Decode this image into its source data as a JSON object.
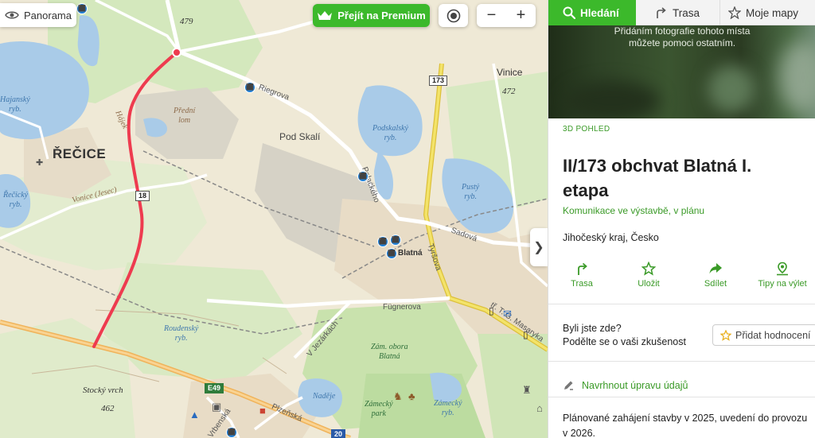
{
  "map": {
    "panorama_label": "Panorama",
    "premium_label": "Přejít na Premium",
    "zoom_out": "−",
    "zoom_in": "+",
    "collapse_arrow": "❯",
    "labels": {
      "town_recice": "ŘEČICE",
      "village_pod_skali": "Pod Skalí",
      "vinice": "Vinice",
      "vinice_elev": "472",
      "top_elev": "479",
      "hajansky": "Hajanský\nryb.",
      "recicky": "Řečický\nryb.",
      "podskalsky": "Podskalský\nryb.",
      "pusty": "Pustý\nryb.",
      "roudensky": "Roudenský\nryb.",
      "nadeje": "Naděje",
      "zamecky": "Zámecký\nryb.",
      "predni_lom": "Přední\nlom",
      "stocky_vrch": "Stocký vrch",
      "stocky_elev": "462",
      "zam_obora": "Zám. obora\nBlatná",
      "zamecky_park": "Zámecký\npark",
      "riegrova": "Riegrova",
      "palackeho": "Palackého",
      "sadova": "Sadová",
      "tyrsova": "Tyršova",
      "fugnerova": "Fügnerova",
      "v_jezarkach": "V Jezárkách",
      "plzenska": "Plzeňská",
      "vrbenska": "Vrbenská",
      "masarykova": "tř. T. G. Masaryka",
      "blatna": "Blatná",
      "vonice": "Vonice (Jesec)",
      "hajek": "Hájek"
    },
    "shields": {
      "r173": "173",
      "e49": "E49",
      "r20": "20",
      "r18": "18"
    }
  },
  "panel": {
    "tabs": [
      {
        "label": "Hledání",
        "icon": "search-icon"
      },
      {
        "label": "Trasa",
        "icon": "route-icon"
      },
      {
        "label": "Moje mapy",
        "icon": "star-icon"
      }
    ],
    "photo_caption": "Přidáním fotografie tohoto místa\nmůžete pomoci ostatním.",
    "label_3d": "3D POHLED",
    "title": "II/173 obchvat Blatná I. etapa",
    "type": "Komunikace ve výstavbě, v plánu",
    "region": "Jihočeský kraj, Česko",
    "actions": [
      {
        "label": "Trasa",
        "icon": "route-icon"
      },
      {
        "label": "Uložit",
        "icon": "star-icon"
      },
      {
        "label": "Sdílet",
        "icon": "share-icon"
      },
      {
        "label": "Tipy na výlet",
        "icon": "location-pin-icon"
      }
    ],
    "visited_line1": "Byli jste zde?",
    "visited_line2": "Podělte se o vaši zkušenost",
    "rate_button": "Přidat hodnocení",
    "suggest_edit": "Navrhnout úpravu údajů",
    "description": "Plánované zahájení stavby v 2025, uvedení do provozu v 2026."
  },
  "colors": {
    "accent_green": "#3cb92b",
    "link_green": "#3a9a27",
    "route_red": "#ee3b4f",
    "water": "#a9cbe8",
    "forest": "#cfe6b3"
  }
}
